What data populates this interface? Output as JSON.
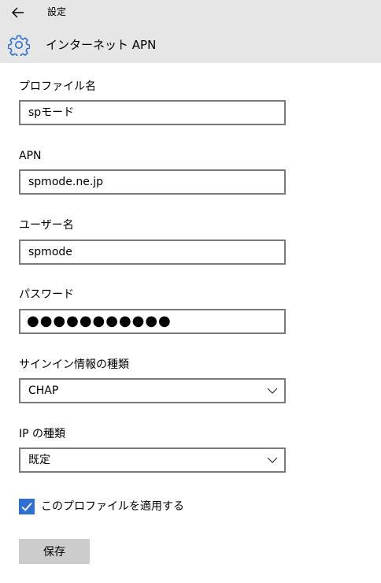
{
  "header": {
    "breadcrumb": "設定",
    "title": "インターネット APN",
    "back_icon": "arrow-left-icon",
    "settings_icon": "gear-icon"
  },
  "form": {
    "profile_name": {
      "label": "プロファイル名",
      "value": "spモード"
    },
    "apn": {
      "label": "APN",
      "value": "spmode.ne.jp"
    },
    "username": {
      "label": "ユーザー名",
      "value": "spmode"
    },
    "password": {
      "label": "パスワード",
      "value": "●●●●●●●●●●●"
    },
    "auth_type": {
      "label": "サインイン情報の種類",
      "value": "CHAP"
    },
    "ip_type": {
      "label": "IP の種類",
      "value": "既定"
    },
    "apply_profile": {
      "label": "このプロファイルを適用する",
      "checked": true
    },
    "save_label": "保存"
  },
  "colors": {
    "header_bg": "#e6e6e6",
    "accent": "#2f6fcf",
    "button_bg": "#cccccc",
    "border": "#7a7a7a"
  }
}
